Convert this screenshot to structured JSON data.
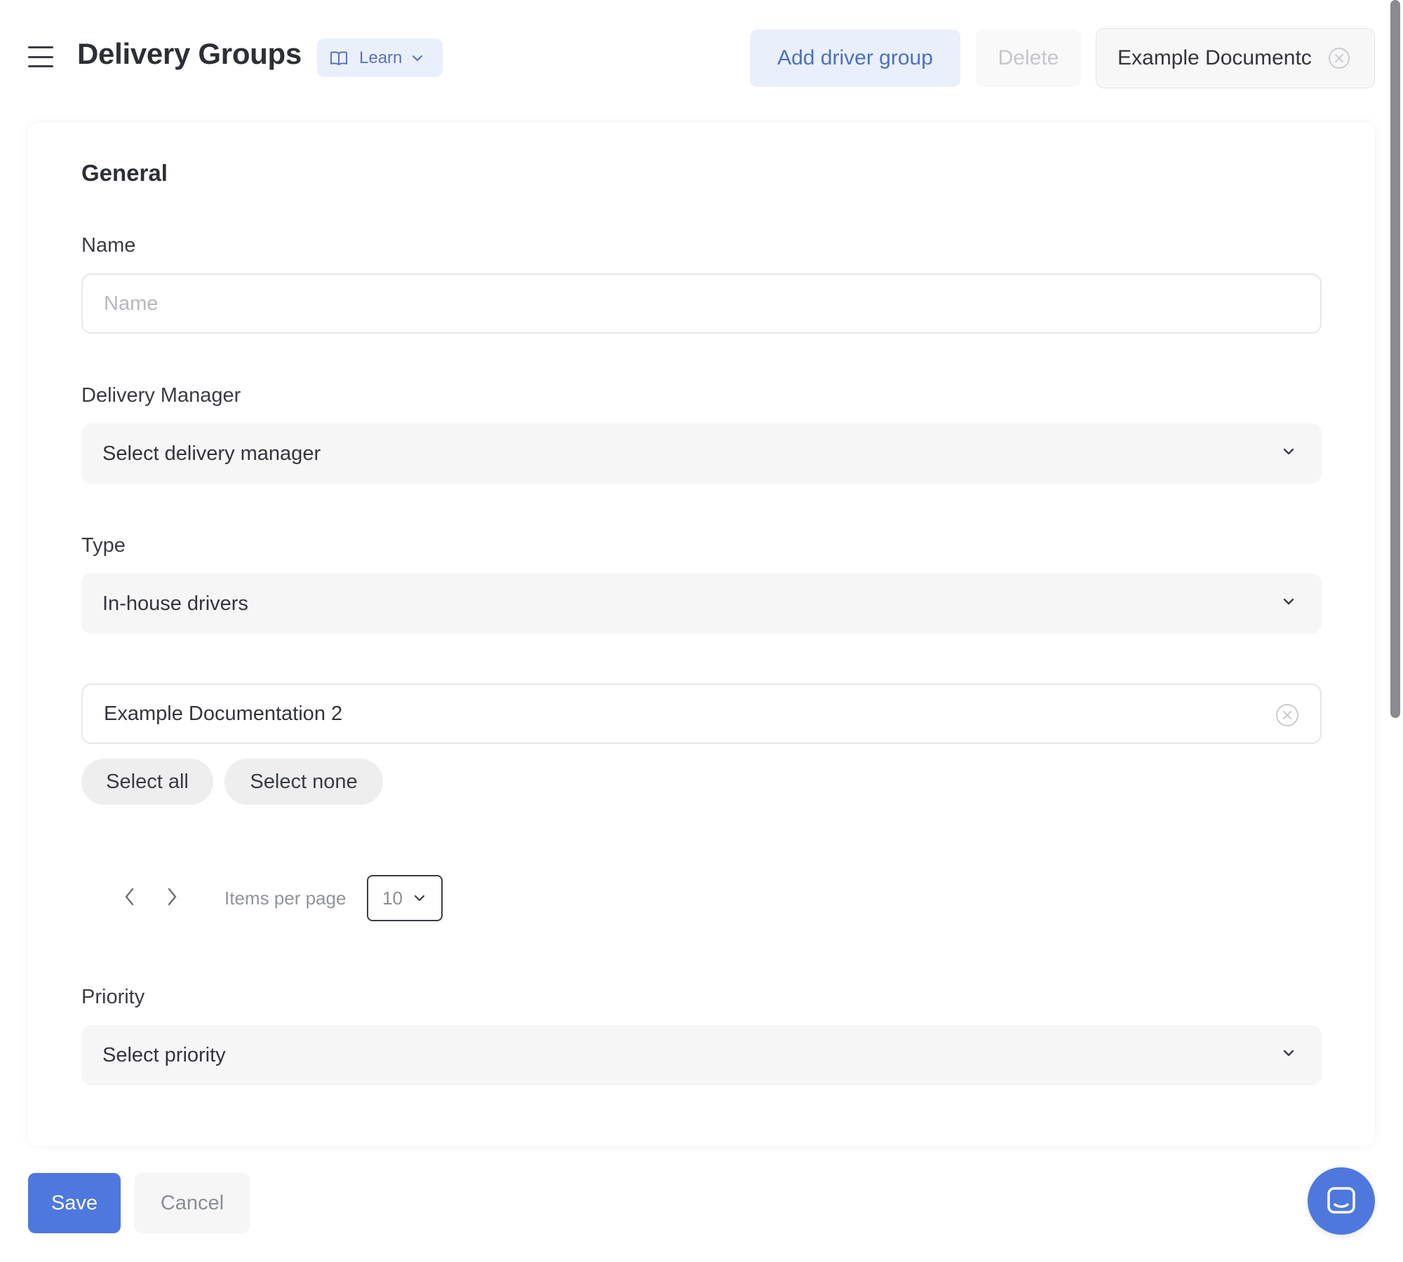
{
  "header": {
    "menu_icon": "hamburger-menu-icon",
    "title": "Delivery Groups",
    "learn": {
      "icon": "book-icon",
      "label": "Learn"
    },
    "add_driver_group_label": "Add driver group",
    "delete_label": "Delete",
    "document_chip": {
      "label": "Example Documentc",
      "clear_icon": "circle-x-icon"
    }
  },
  "form": {
    "section_title": "General",
    "name": {
      "label": "Name",
      "placeholder": "Name",
      "value": ""
    },
    "delivery_manager": {
      "label": "Delivery Manager",
      "value": "Select delivery manager"
    },
    "type": {
      "label": "Type",
      "value": "In-house drivers"
    },
    "documentation": {
      "value": "Example Documentation 2"
    },
    "select_all_label": "Select all",
    "select_none_label": "Select none",
    "pagination": {
      "items_per_page_label": "Items per page",
      "items_per_page_value": "10"
    },
    "priority": {
      "label": "Priority",
      "value": "Select priority"
    }
  },
  "footer": {
    "save_label": "Save",
    "cancel_label": "Cancel",
    "chat_icon": "chat-icon"
  },
  "colors": {
    "primary": "#4e78dd",
    "accent_light": "#e9f0fb",
    "text": "#2d2f36",
    "muted": "#8a8d94"
  }
}
